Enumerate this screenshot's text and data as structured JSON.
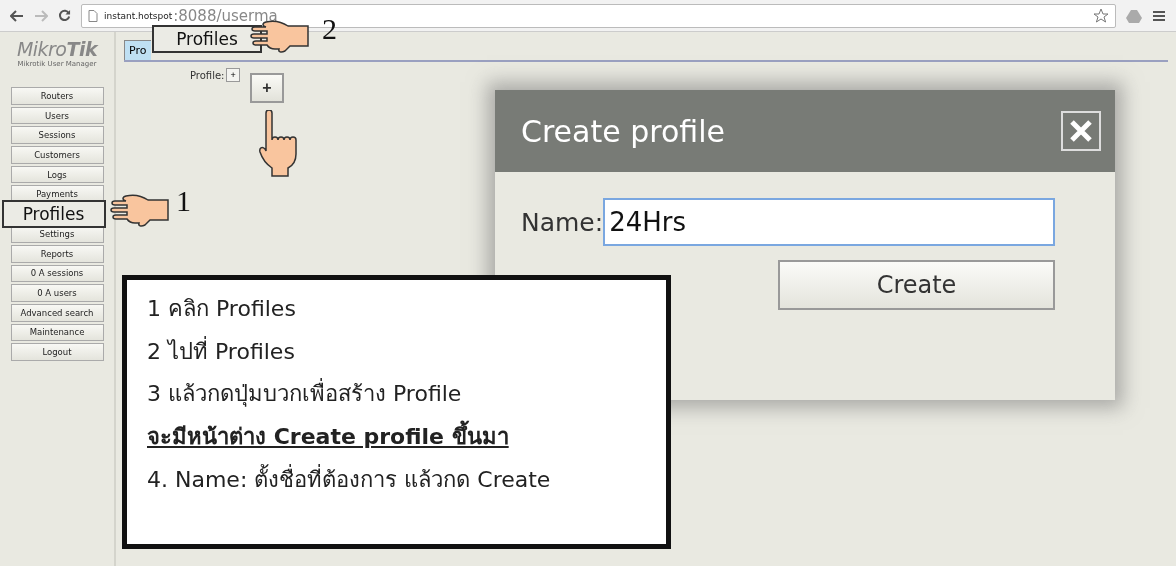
{
  "browser": {
    "url_host": "instant.hotspot",
    "url_path": ":8088/userma"
  },
  "logo": {
    "brand": "Mikro**Tik**",
    "subtitle": "Mikrotik User Manager"
  },
  "sidebar": {
    "items": [
      {
        "label": "Routers",
        "kind": "button"
      },
      {
        "label": "Users",
        "kind": "button"
      },
      {
        "label": "Sessions",
        "kind": "button"
      },
      {
        "label": "Customers",
        "kind": "button"
      },
      {
        "label": "Logs",
        "kind": "button"
      },
      {
        "label": "Payments",
        "kind": "button"
      },
      {
        "label": "Profiles",
        "kind": "callout"
      },
      {
        "label": "Settings",
        "kind": "button"
      },
      {
        "label": "Reports",
        "kind": "button"
      },
      {
        "label": "0 A sessions",
        "kind": "button"
      },
      {
        "label": "0 A users",
        "kind": "button"
      },
      {
        "label": "Advanced search",
        "kind": "button"
      },
      {
        "label": "Maintenance",
        "kind": "button"
      },
      {
        "label": "Logout",
        "kind": "button"
      }
    ]
  },
  "tabs": [
    {
      "label": "Pro",
      "selected": true
    }
  ],
  "tab_callout": "Profiles",
  "profile_row": {
    "label": "Profile:",
    "button": "+",
    "callout_button": "+"
  },
  "markers": [
    {
      "number": "1"
    },
    {
      "number": "2"
    }
  ],
  "dialog": {
    "title": "Create profile",
    "name_label": "Name:",
    "name_value": "24Hrs",
    "button": "Create"
  },
  "instructions": [
    {
      "text": "1  คลิก Profiles",
      "kind": "step"
    },
    {
      "text": "2 ไปที่ Profiles",
      "kind": "step"
    },
    {
      "text": "3 แล้วกดปุ่มบวกเพื่อสร้าง Profile",
      "kind": "step"
    },
    {
      "text": "จะมีหน้าต่าง Create profile ขึ้นมา",
      "kind": "note"
    },
    {
      "text": "4. Name: ตั้งชื่อที่ต้องการ  แล้วกด Create",
      "kind": "step"
    }
  ]
}
